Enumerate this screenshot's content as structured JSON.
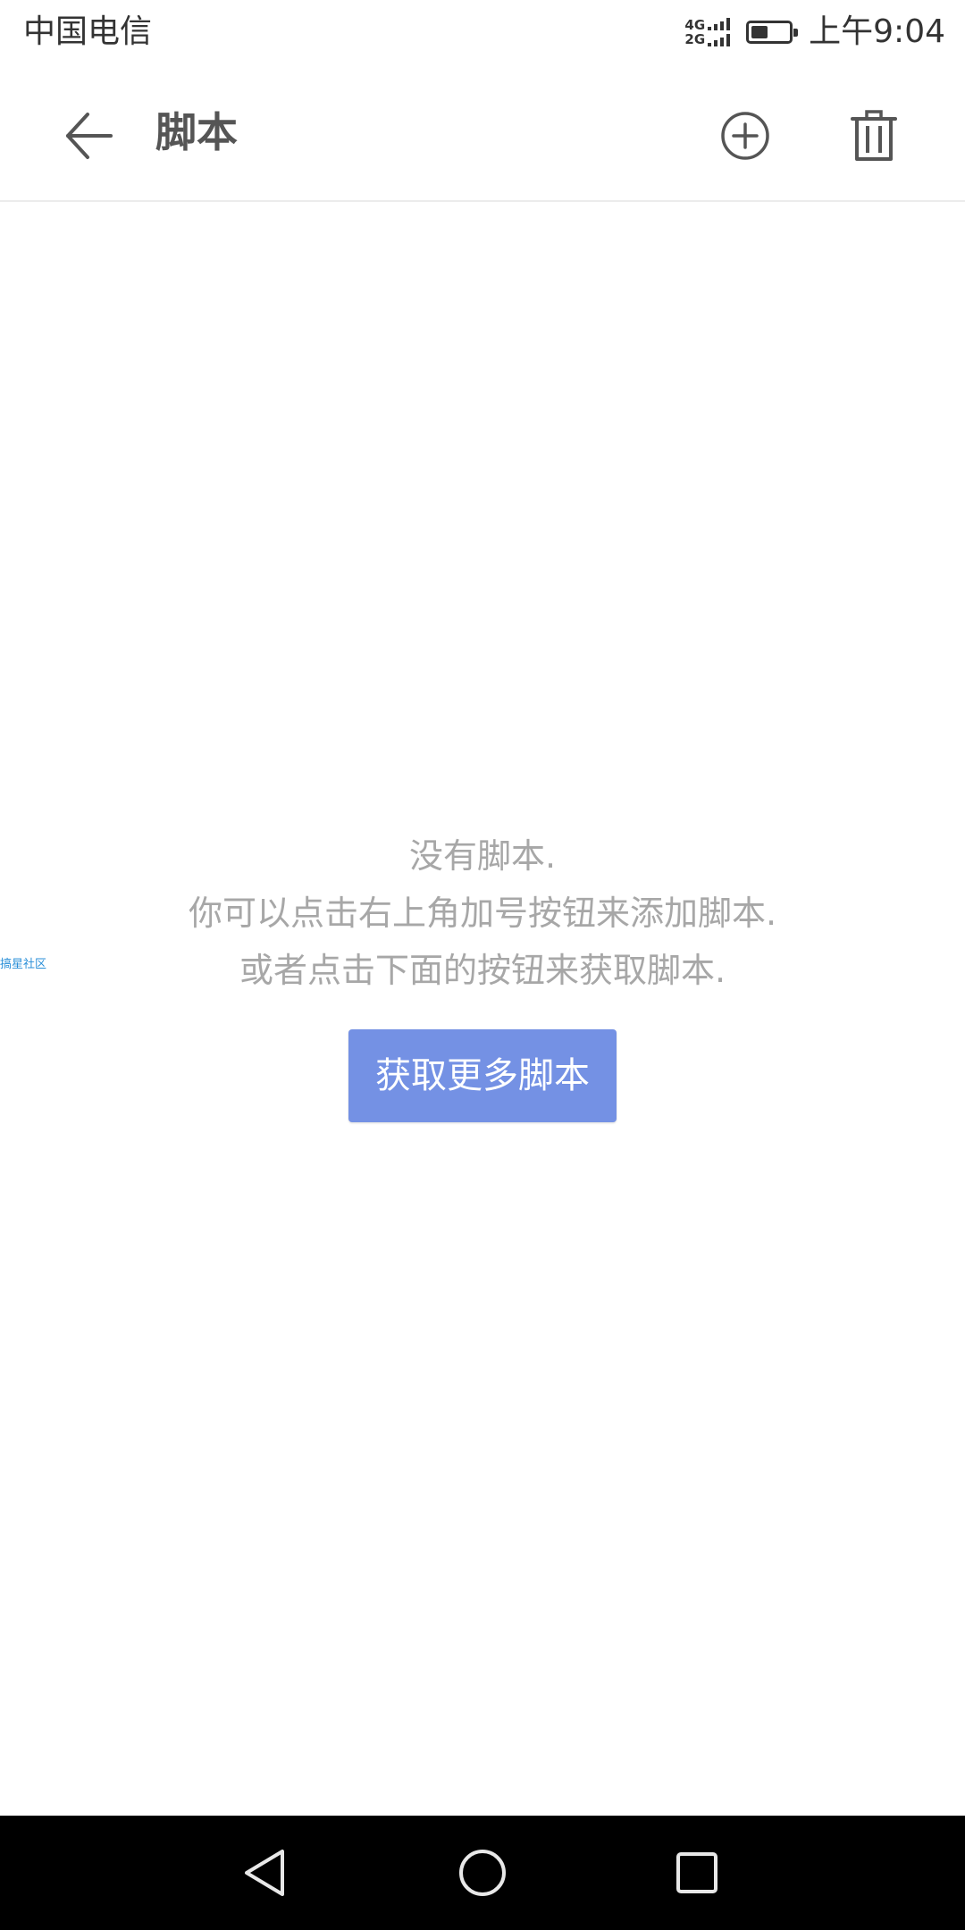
{
  "status_bar": {
    "carrier": "中国电信",
    "network_top": "4G",
    "network_bottom": "2G",
    "battery_level": 0.45,
    "time": "上午9:04"
  },
  "app_bar": {
    "title": "脚本",
    "back_icon": "arrow-left-icon",
    "add_icon": "plus-circle-icon",
    "delete_icon": "trash-icon"
  },
  "empty_state": {
    "line1": "没有脚本.",
    "line2": "你可以点击右上角加号按钮来添加脚本.",
    "line3": "或者点击下面的按钮来获取脚本.",
    "button_label": "获取更多脚本"
  },
  "side_link": {
    "label": "搞星社区"
  },
  "nav_bar": {
    "back_icon": "triangle-back-icon",
    "home_icon": "circle-home-icon",
    "recents_icon": "square-recents-icon"
  },
  "colors": {
    "accent": "#7491e4",
    "muted_text": "#a7a7a7",
    "title_text": "#555555",
    "link": "#2a8fd8"
  }
}
